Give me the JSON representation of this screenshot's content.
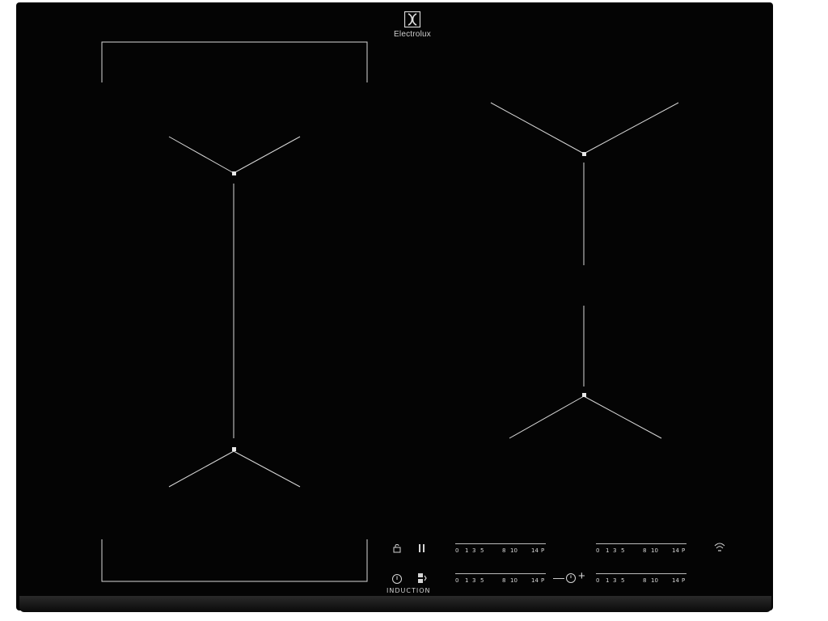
{
  "brand": {
    "name": "Electrolux"
  },
  "controls": {
    "lock_icon": "lock-icon",
    "pause_icon": "pause-icon",
    "power_icon": "power-icon",
    "bridge_icon": "bridge-icon",
    "timer_minus": "—",
    "timer_plus": "+",
    "wifi_icon": "wifi-icon",
    "induction_label": "INDUCTION"
  },
  "scales": [
    {
      "labels": [
        "0",
        "1",
        "3",
        "5",
        "8",
        "10",
        "14",
        "P"
      ]
    },
    {
      "labels": [
        "0",
        "1",
        "3",
        "5",
        "8",
        "10",
        "14",
        "P"
      ]
    },
    {
      "labels": [
        "0",
        "1",
        "3",
        "5",
        "8",
        "10",
        "14",
        "P"
      ]
    },
    {
      "labels": [
        "0",
        "1",
        "3",
        "5",
        "8",
        "10",
        "14",
        "P"
      ]
    }
  ]
}
